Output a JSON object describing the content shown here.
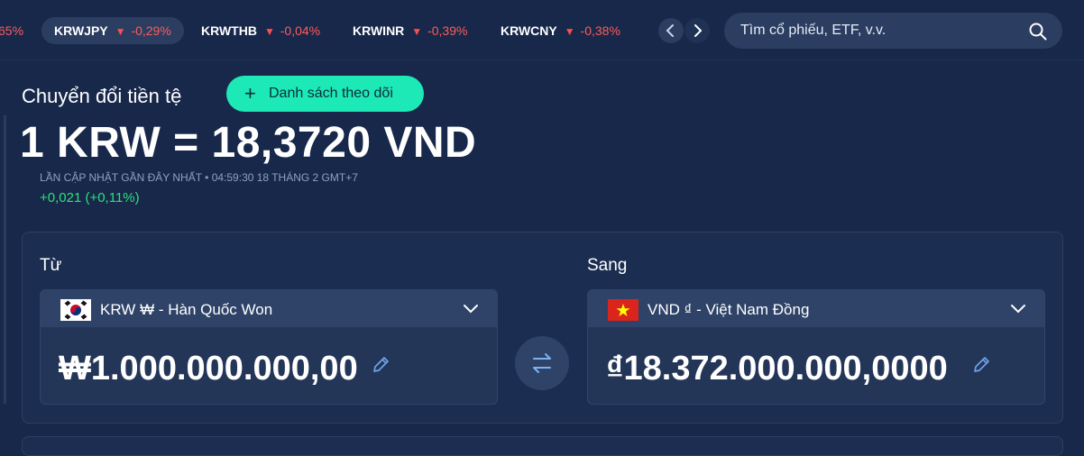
{
  "ticker": {
    "items": [
      {
        "symbol": "",
        "change": "65%"
      },
      {
        "symbol": "KRWJPY",
        "change": "-0,29%"
      },
      {
        "symbol": "KRWTHB",
        "change": "-0,04%"
      },
      {
        "symbol": "KRWINR",
        "change": "-0,39%"
      },
      {
        "symbol": "KRWCNY",
        "change": "-0,38%"
      }
    ],
    "prev_icon": "chevron-left-icon",
    "next_icon": "chevron-right-icon"
  },
  "search": {
    "placeholder": "Tìm cổ phiếu, ETF, v.v.",
    "icon": "search-icon"
  },
  "header": {
    "title": "Chuyển đổi tiền tệ",
    "watchlist_label": "Danh sách theo dõi",
    "watchlist_plus": "+"
  },
  "rate": {
    "text": "1 KRW = 18,3720 VND",
    "updated": "LẦN CẬP NHẬT GẦN ĐÂY NHẤT • 04:59:30 18 THÁNG 2 GMT+7",
    "delta": "+0,021 (+0,11%)"
  },
  "converter": {
    "from_label": "Từ",
    "to_label": "Sang",
    "from": {
      "currency": "KRW ₩ - Hàn Quốc Won",
      "amount": "₩1.000.000.000,00",
      "flag": "south-korea-flag"
    },
    "to": {
      "currency": "VND ₫ - Việt Nam Đồng",
      "amount": "₫18.372.000.000,0000",
      "flag": "vietnam-flag"
    }
  },
  "colors": {
    "background": "#17284a",
    "accent": "#1de9b6",
    "positive": "#2ee07a",
    "negative": "#ff5b5b"
  }
}
